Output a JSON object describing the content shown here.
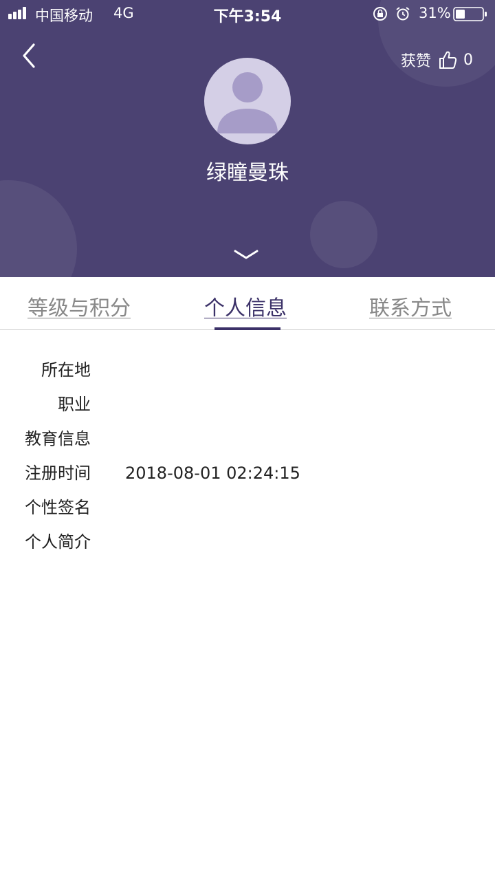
{
  "status_bar": {
    "carrier": "中国移动",
    "network": "4G",
    "time": "下午3:54",
    "battery": "31%",
    "icons": [
      "signal-icon",
      "lock-rotation-icon",
      "alarm-icon",
      "battery-icon"
    ]
  },
  "header": {
    "back_icon": "chevron-left-icon",
    "likes_label": "获赞",
    "likes_icon": "thumbs-up-icon",
    "likes_count": "0",
    "username": "绿瞳曼珠",
    "expand_icon": "chevron-down-icon",
    "background_color": "#4b4272"
  },
  "tabs": [
    {
      "label": "等级与积分",
      "active": false
    },
    {
      "label": "个人信息",
      "active": true
    },
    {
      "label": "联系方式",
      "active": false
    }
  ],
  "info_rows": [
    {
      "label": "所在地",
      "value": ""
    },
    {
      "label": "职业",
      "value": ""
    },
    {
      "label": "教育信息",
      "value": ""
    },
    {
      "label": "注册时间",
      "value": "2018-08-01 02:24:15"
    },
    {
      "label": "个性签名",
      "value": ""
    },
    {
      "label": "个人简介",
      "value": ""
    }
  ],
  "colors": {
    "accent": "#3b3168",
    "tab_inactive": "#888888"
  }
}
